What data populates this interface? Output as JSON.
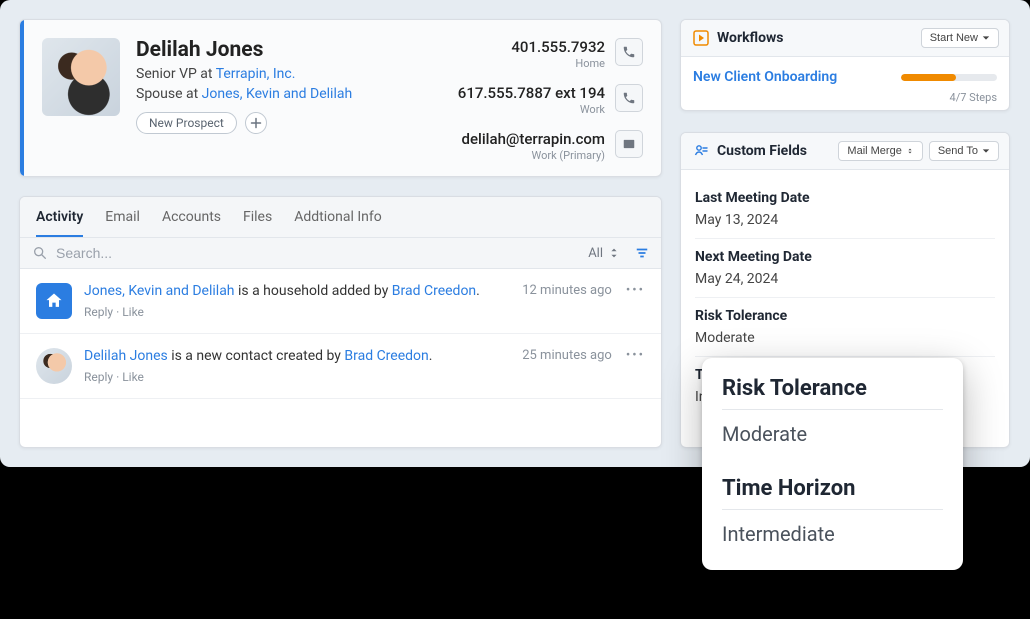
{
  "contact": {
    "name": "Delilah Jones",
    "role_prefix": "Senior VP at ",
    "role_company": "Terrapin, Inc.",
    "spouse_prefix": "Spouse at ",
    "spouse_link": "Jones, Kevin and Delilah",
    "tag": "New Prospect",
    "phones": [
      {
        "value": "401.555.7932",
        "label": "Home"
      },
      {
        "value": "617.555.7887 ext 194",
        "label": "Work"
      }
    ],
    "email": {
      "value": "delilah@terrapin.com",
      "label": "Work (Primary)"
    }
  },
  "tabs": [
    "Activity",
    "Email",
    "Accounts",
    "Files",
    "Addtional Info"
  ],
  "active_tab_index": 0,
  "search": {
    "placeholder": "Search..."
  },
  "filter_all": "All",
  "feed": [
    {
      "icon": "house",
      "link1": "Jones, Kevin and Delilah",
      "mid": " is a household added by ",
      "link2": "Brad Creedon",
      "tail": ".",
      "time": "12 minutes ago",
      "meta_reply": "Reply",
      "meta_like": "Like"
    },
    {
      "icon": "avatar",
      "link1": "Delilah Jones",
      "mid": " is a new contact created by ",
      "link2": "Brad Creedon",
      "tail": ".",
      "time": "25 minutes ago",
      "meta_reply": "Reply",
      "meta_like": "Like"
    }
  ],
  "workflows": {
    "title": "Workflows",
    "start_new": "Start New",
    "link": "New Client Onboarding",
    "steps_text": "4/7 Steps",
    "progress_pct": 57
  },
  "custom_fields": {
    "title": "Custom Fields",
    "mail_merge": "Mail Merge",
    "send_to": "Send To",
    "rows": [
      {
        "label": "Last Meeting Date",
        "value": "May 13, 2024"
      },
      {
        "label": "Next Meeting Date",
        "value": "May 24, 2024"
      },
      {
        "label": "Risk Tolerance",
        "value": "Moderate"
      },
      {
        "label": "Time Horizon",
        "value": "Intermediate"
      }
    ]
  },
  "popover": {
    "label1": "Risk Tolerance",
    "value1": "Moderate",
    "label2": "Time Horizon",
    "value2": "Intermediate"
  }
}
